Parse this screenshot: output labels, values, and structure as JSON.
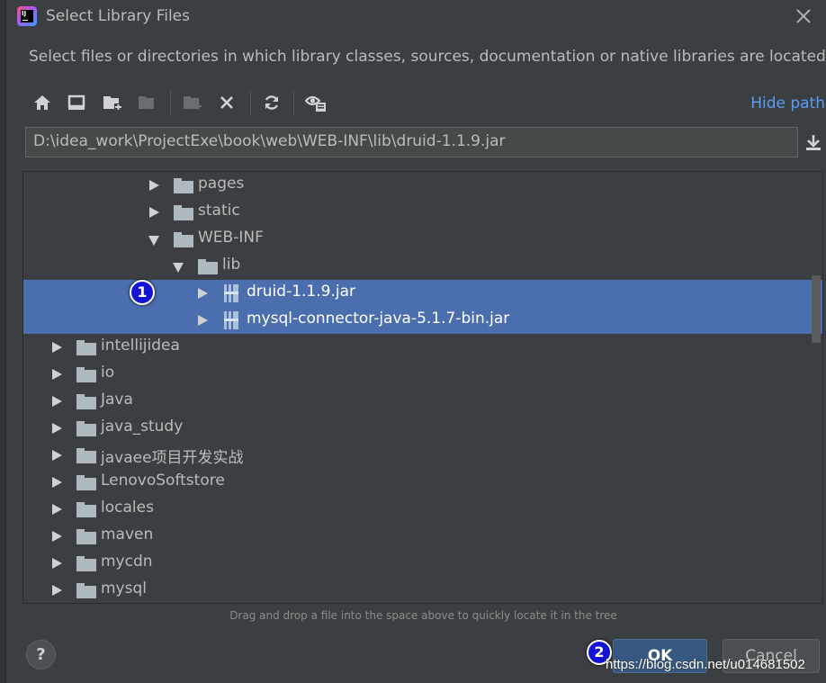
{
  "dialog": {
    "title": "Select Library Files",
    "description": "Select files or directories in which library classes, sources, documentation or native libraries are located",
    "hide_path_label": "Hide path",
    "path_value": "D:\\idea_work\\ProjectExe\\book\\web\\WEB-INF\\lib\\druid-1.1.9.jar",
    "hint": "Drag and drop a file into the space above to quickly locate it in the tree",
    "ok_label": "OK",
    "cancel_label": "Cancel",
    "help_label": "?"
  },
  "toolbar": {
    "icons": [
      "home-icon",
      "desktop-icon",
      "new-folder-icon",
      "new-folder-disabled-icon",
      "new-folder-disabled-icon",
      "delete-icon",
      "refresh-icon",
      "show-hidden-icon"
    ]
  },
  "tree": {
    "items": [
      {
        "label": "pages",
        "type": "folder",
        "state": "collapsed",
        "selected": false
      },
      {
        "label": "static",
        "type": "folder",
        "state": "collapsed",
        "selected": false
      },
      {
        "label": "WEB-INF",
        "type": "folder",
        "state": "expanded",
        "selected": false
      },
      {
        "label": "lib",
        "type": "folder",
        "state": "expanded",
        "selected": false
      },
      {
        "label": "druid-1.1.9.jar",
        "type": "jar",
        "state": "collapsed",
        "selected": true
      },
      {
        "label": "mysql-connector-java-5.1.7-bin.jar",
        "type": "jar",
        "state": "collapsed",
        "selected": true
      },
      {
        "label": "intellijidea",
        "type": "folder",
        "state": "collapsed",
        "selected": false
      },
      {
        "label": "io",
        "type": "folder",
        "state": "collapsed",
        "selected": false
      },
      {
        "label": "Java",
        "type": "folder",
        "state": "collapsed",
        "selected": false
      },
      {
        "label": "java_study",
        "type": "folder",
        "state": "collapsed",
        "selected": false
      },
      {
        "label": "javaee项目开发实战",
        "type": "folder",
        "state": "collapsed",
        "selected": false
      },
      {
        "label": "LenovoSoftstore",
        "type": "folder",
        "state": "collapsed",
        "selected": false
      },
      {
        "label": "locales",
        "type": "folder",
        "state": "collapsed",
        "selected": false
      },
      {
        "label": "maven",
        "type": "folder",
        "state": "collapsed",
        "selected": false
      },
      {
        "label": "mycdn",
        "type": "folder",
        "state": "collapsed",
        "selected": false
      },
      {
        "label": "mysql",
        "type": "folder",
        "state": "collapsed",
        "selected": false
      }
    ]
  },
  "annotations": {
    "badge1": "1",
    "badge2": "2",
    "watermark": "https://blog.csdn.net/u014681502"
  },
  "colors": {
    "selection": "#4b6eaf",
    "link": "#589df6",
    "badge": "#1414d2"
  }
}
